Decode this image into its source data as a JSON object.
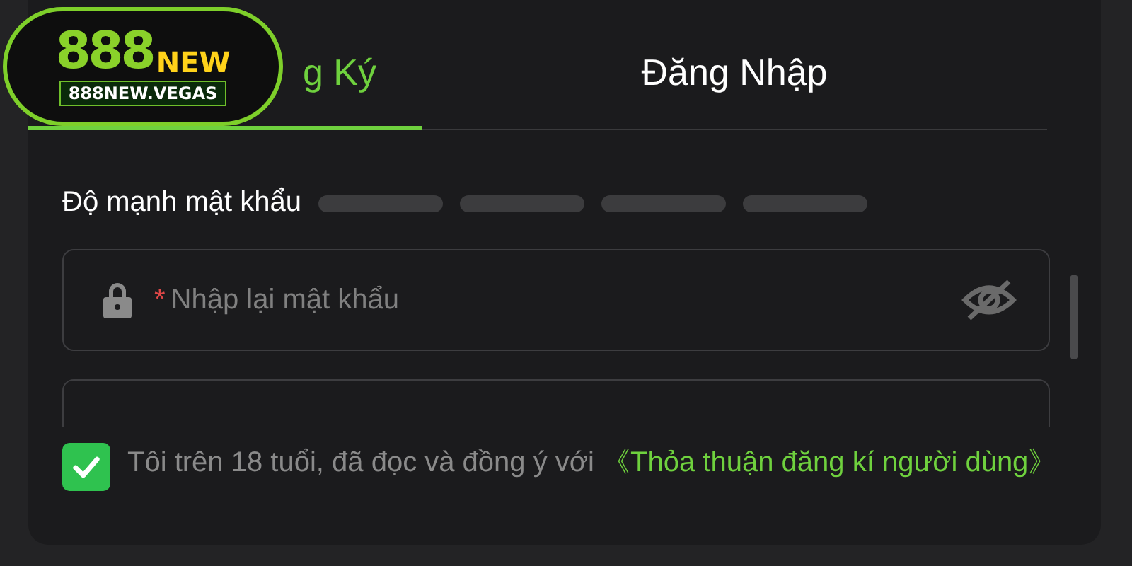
{
  "logo": {
    "digits": "888",
    "word": "NEW",
    "domain": "888NEW.VEGAS"
  },
  "tabs": [
    {
      "label": "g Ký",
      "selected": true
    },
    {
      "label": "Đăng Nhập",
      "selected": false
    }
  ],
  "strength": {
    "label": "Độ mạnh mật khẩu",
    "bars": [
      {
        "filled": false
      },
      {
        "filled": false
      },
      {
        "filled": false
      },
      {
        "filled": false
      }
    ]
  },
  "fields": [
    {
      "kind": "password",
      "mark": "*",
      "placeholder": "Nhập lại mật khẩu"
    },
    {
      "kind": "partial"
    }
  ],
  "agreement": {
    "checked": true,
    "text": "Tôi trên 18 tuổi, đã đọc và đồng ý với",
    "link": "《Thỏa thuận đăng kí người dùng》"
  }
}
